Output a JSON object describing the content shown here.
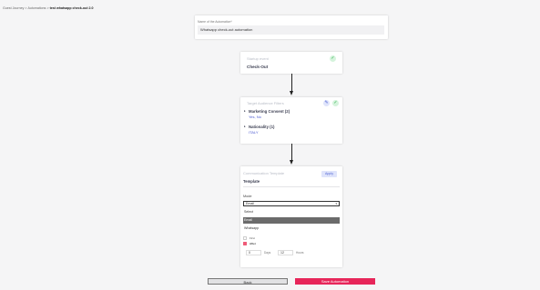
{
  "breadcrumb": [
    "Guest Journey",
    "Automations",
    "test whatsapp check-out 2.0"
  ],
  "name_field": {
    "label": "Name of the Automation*",
    "value": "Whatsapp check-out automation"
  },
  "startup": {
    "title": "Startup event",
    "value": "Check-Out"
  },
  "filters": {
    "title": "Target Audience Filters",
    "groups": [
      {
        "label": "Marketing Consent (2)",
        "values": "Yes, No"
      },
      {
        "label": "Nationality (1)",
        "values": "ITALY"
      }
    ]
  },
  "communication": {
    "title": "Communication Template",
    "apply_label": "Apply",
    "template_label": "Template",
    "mode_label": "Mode",
    "mode_value": "Email",
    "options": [
      "Select",
      "Email",
      "Whatsapp"
    ],
    "selected_option": "Email",
    "timing": {
      "first_label": "First",
      "after_label": "After",
      "days_value": "0",
      "days_unit": "Days",
      "hours_value": "12",
      "hours_unit": "Hours"
    }
  },
  "buttons": {
    "back": "Back",
    "save": "Save Automation"
  },
  "icons": {
    "check": "✓",
    "edit": "✎",
    "caret": "▾",
    "expand": "▸"
  },
  "colors": {
    "accent": "#e7265a",
    "success": "#2fb34f",
    "link": "#4c5bd1"
  }
}
